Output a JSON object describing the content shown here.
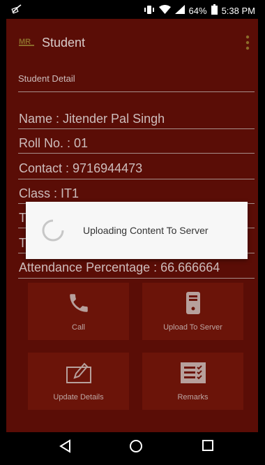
{
  "status_bar": {
    "battery_percent": "64%",
    "time": "5:38 PM"
  },
  "app": {
    "title": "Student"
  },
  "section": {
    "title": "Student Detail"
  },
  "student": {
    "name": "Name : Jitender Pal Singh",
    "roll": "Roll No. :  01",
    "contact": "Contact : 9716944473",
    "class": "Class : IT1",
    "hidden_row_1": "T",
    "hidden_row_2": "T",
    "attendance": "Attendance Percentage : 66.666664"
  },
  "actions": {
    "call": "Call",
    "upload": "Upload To Server",
    "update": "Update Details",
    "remarks": "Remarks"
  },
  "dialog": {
    "message": "Uploading Content To Server"
  },
  "colors": {
    "background": "#5a0d06",
    "tile": "#6b1409",
    "dialog": "#f7f7f7"
  },
  "icons": [
    "no-sim-icon",
    "vibrate-icon",
    "wifi-icon",
    "signal-icon",
    "battery-icon",
    "app-logo",
    "overflow-menu-icon",
    "phone-icon",
    "device-upload-icon",
    "edit-icon",
    "checklist-icon",
    "back-icon",
    "home-icon",
    "recents-icon"
  ]
}
